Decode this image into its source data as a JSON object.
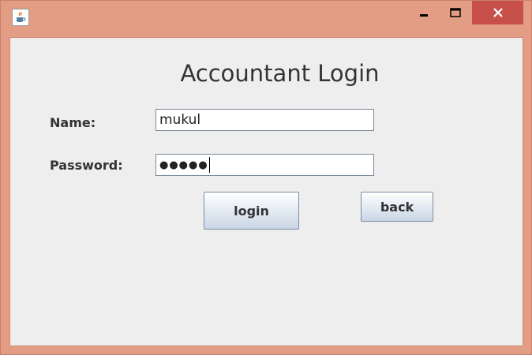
{
  "window": {
    "icon": "java-coffee-cup-icon",
    "controls": {
      "minimize": "minimize-icon",
      "maximize": "maximize-icon",
      "close": "close-icon",
      "close_color": "#c7504b"
    }
  },
  "form": {
    "title": "Accountant Login",
    "name_label": "Name:",
    "name_value": "mukul",
    "password_label": "Password:",
    "password_masked": "●●●●●"
  },
  "buttons": {
    "login": "login",
    "back": "back"
  },
  "colors": {
    "frame": "#e39d84",
    "client_bg": "#eeeeee"
  }
}
